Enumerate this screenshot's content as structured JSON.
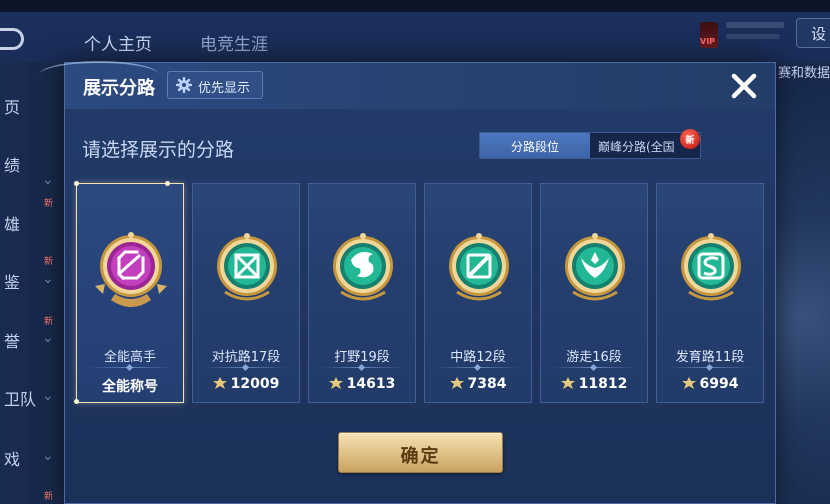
{
  "background": {
    "tabs": [
      "个人主页",
      "电竞生涯"
    ],
    "vip_label": "VIP",
    "settings_label": "设",
    "right_text": "赛和数据展",
    "sidebar_items": [
      "页",
      "绩",
      "雄",
      "鉴",
      "誉",
      "卫队",
      "戏"
    ],
    "new_badge": "新"
  },
  "modal": {
    "title": "展示分路",
    "priority_tag": "优先显示",
    "subtitle": "请选择展示的分路",
    "toggle": {
      "active": "分路段位",
      "inactive": "巅峰分路(全国",
      "badge": "新"
    },
    "cards": [
      {
        "name": "全能高手",
        "label": "全能称号",
        "selected": true,
        "emblem_color": "#c02fb8",
        "icon": "allround-icon"
      },
      {
        "name": "对抗路17段",
        "score": "12009",
        "selected": false,
        "emblem_color": "#1fb79a",
        "icon": "clash-lane-icon"
      },
      {
        "name": "打野19段",
        "score": "14613",
        "selected": false,
        "emblem_color": "#1fb79a",
        "icon": "jungle-icon"
      },
      {
        "name": "中路12段",
        "score": "7384",
        "selected": false,
        "emblem_color": "#1fb79a",
        "icon": "mid-lane-icon"
      },
      {
        "name": "游走16段",
        "score": "11812",
        "selected": false,
        "emblem_color": "#1fb79a",
        "icon": "roam-icon"
      },
      {
        "name": "发育路11段",
        "score": "6994",
        "selected": false,
        "emblem_color": "#1fb79a",
        "icon": "farm-lane-icon"
      }
    ],
    "confirm_label": "确定"
  }
}
